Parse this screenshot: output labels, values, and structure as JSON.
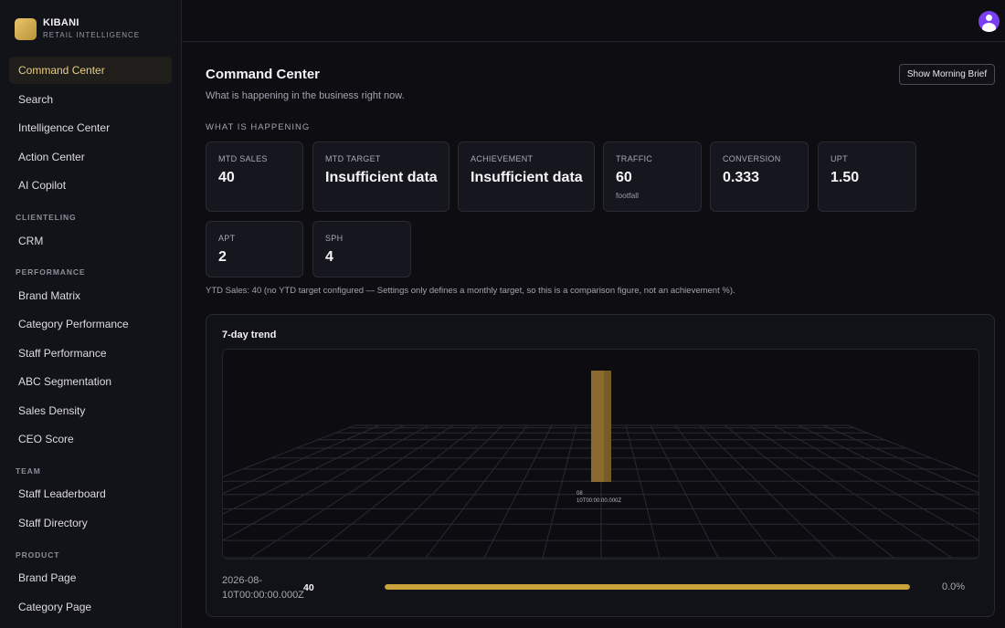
{
  "brand": {
    "name": "KIBANI",
    "subtitle": "RETAIL INTELLIGENCE"
  },
  "sidebar": {
    "main_items": [
      {
        "label": "Command Center",
        "active": true
      },
      {
        "label": "Search"
      },
      {
        "label": "Intelligence Center"
      },
      {
        "label": "Action Center"
      },
      {
        "label": "AI Copilot"
      }
    ],
    "sections": [
      {
        "title": "CLIENTELING",
        "items": [
          {
            "label": "CRM"
          }
        ]
      },
      {
        "title": "PERFORMANCE",
        "items": [
          {
            "label": "Brand Matrix"
          },
          {
            "label": "Category Performance"
          },
          {
            "label": "Staff Performance"
          },
          {
            "label": "ABC Segmentation"
          },
          {
            "label": "Sales Density"
          },
          {
            "label": "CEO Score"
          }
        ]
      },
      {
        "title": "TEAM",
        "items": [
          {
            "label": "Staff Leaderboard"
          },
          {
            "label": "Staff Directory"
          }
        ]
      },
      {
        "title": "PRODUCT",
        "items": [
          {
            "label": "Brand Page"
          },
          {
            "label": "Category Page"
          }
        ]
      }
    ]
  },
  "header": {
    "title": "Command Center",
    "subtitle": "What is happening in the business right now.",
    "brief_button": "Show Morning Brief"
  },
  "kpis": {
    "section_label": "WHAT IS HAPPENING",
    "cards": [
      {
        "label": "MTD SALES",
        "value": "40"
      },
      {
        "label": "MTD TARGET",
        "value": "Insufficient data"
      },
      {
        "label": "ACHIEVEMENT",
        "value": "Insufficient data"
      },
      {
        "label": "TRAFFIC",
        "value": "60",
        "note": "footfall"
      },
      {
        "label": "CONVERSION",
        "value": "0.333"
      },
      {
        "label": "UPT",
        "value": "1.50"
      },
      {
        "label": "APT",
        "value": "2"
      },
      {
        "label": "SPH",
        "value": "4"
      }
    ],
    "ytd_note": "YTD Sales: 40 (no YTD target configured — Settings only defines a monthly target, so this is a comparison figure, not an achievement %)."
  },
  "trend": {
    "title": "7-day trend",
    "row": {
      "date": "2026-08-10T00:00:00.000Z",
      "value": "40",
      "percent": "0.0%",
      "fill": 1.0
    }
  },
  "chart_data": {
    "type": "bar",
    "categories": [
      "08\n10T00:00:00.000Z"
    ],
    "values": [
      40
    ],
    "bar_color": "#8a6a2e"
  },
  "colors": {
    "accent": "#e9cd86",
    "bar": "#c9a33a",
    "avatar": "#7b3ff2"
  }
}
